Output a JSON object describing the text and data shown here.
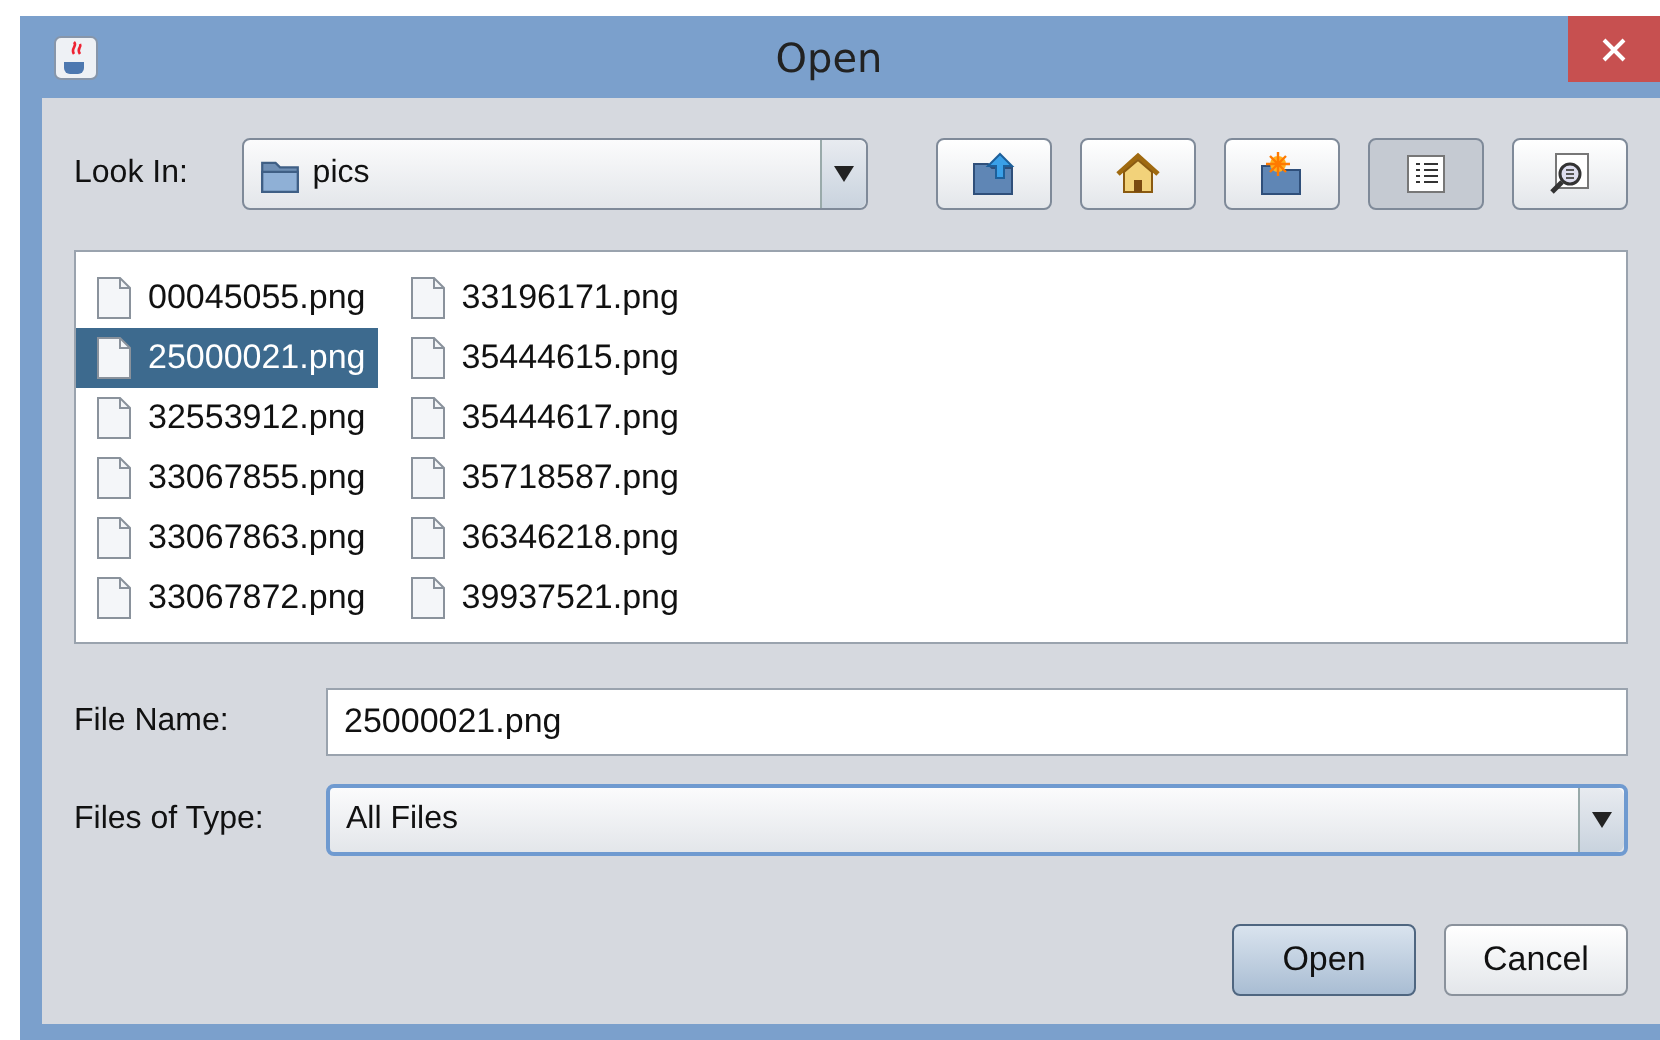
{
  "window": {
    "title": "Open"
  },
  "look_in": {
    "label": "Look In:",
    "value": "pics"
  },
  "toolbar": [
    {
      "kind": "up",
      "selected": false
    },
    {
      "kind": "home",
      "selected": false
    },
    {
      "kind": "new-folder",
      "selected": false
    },
    {
      "kind": "list",
      "selected": true
    },
    {
      "kind": "details",
      "selected": false
    }
  ],
  "files": [
    {
      "name": "00045055.png",
      "selected": false
    },
    {
      "name": "25000021.png",
      "selected": true
    },
    {
      "name": "32553912.png",
      "selected": false
    },
    {
      "name": "33067855.png",
      "selected": false
    },
    {
      "name": "33067863.png",
      "selected": false
    },
    {
      "name": "33067872.png",
      "selected": false
    },
    {
      "name": "33196171.png",
      "selected": false
    },
    {
      "name": "35444615.png",
      "selected": false
    },
    {
      "name": "35444617.png",
      "selected": false
    },
    {
      "name": "35718587.png",
      "selected": false
    },
    {
      "name": "36346218.png",
      "selected": false
    },
    {
      "name": "39937521.png",
      "selected": false
    }
  ],
  "file_name": {
    "label": "File Name:",
    "value": "25000021.png"
  },
  "file_type": {
    "label": "Files of Type:",
    "value": "All Files"
  },
  "buttons": [
    {
      "label": "Open",
      "default": true
    },
    {
      "label": "Cancel",
      "default": false
    }
  ]
}
